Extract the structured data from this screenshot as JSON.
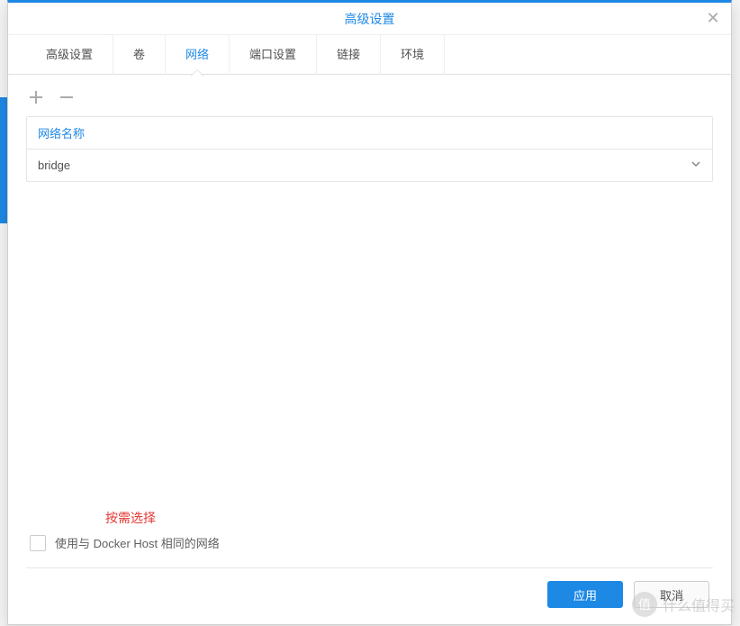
{
  "modal": {
    "title": "高级设置"
  },
  "tabs": [
    {
      "label": "高级设置",
      "active": false
    },
    {
      "label": "卷",
      "active": false
    },
    {
      "label": "网络",
      "active": true
    },
    {
      "label": "端口设置",
      "active": false
    },
    {
      "label": "链接",
      "active": false
    },
    {
      "label": "环境",
      "active": false
    }
  ],
  "table": {
    "header": "网络名称",
    "rows": [
      {
        "value": "bridge"
      }
    ]
  },
  "annotation": "按需选择",
  "checkbox": {
    "label": "使用与 Docker Host 相同的网络",
    "checked": false
  },
  "buttons": {
    "apply": "应用",
    "cancel": "取消"
  },
  "watermark": {
    "badge": "值",
    "text": "什么值得买"
  }
}
